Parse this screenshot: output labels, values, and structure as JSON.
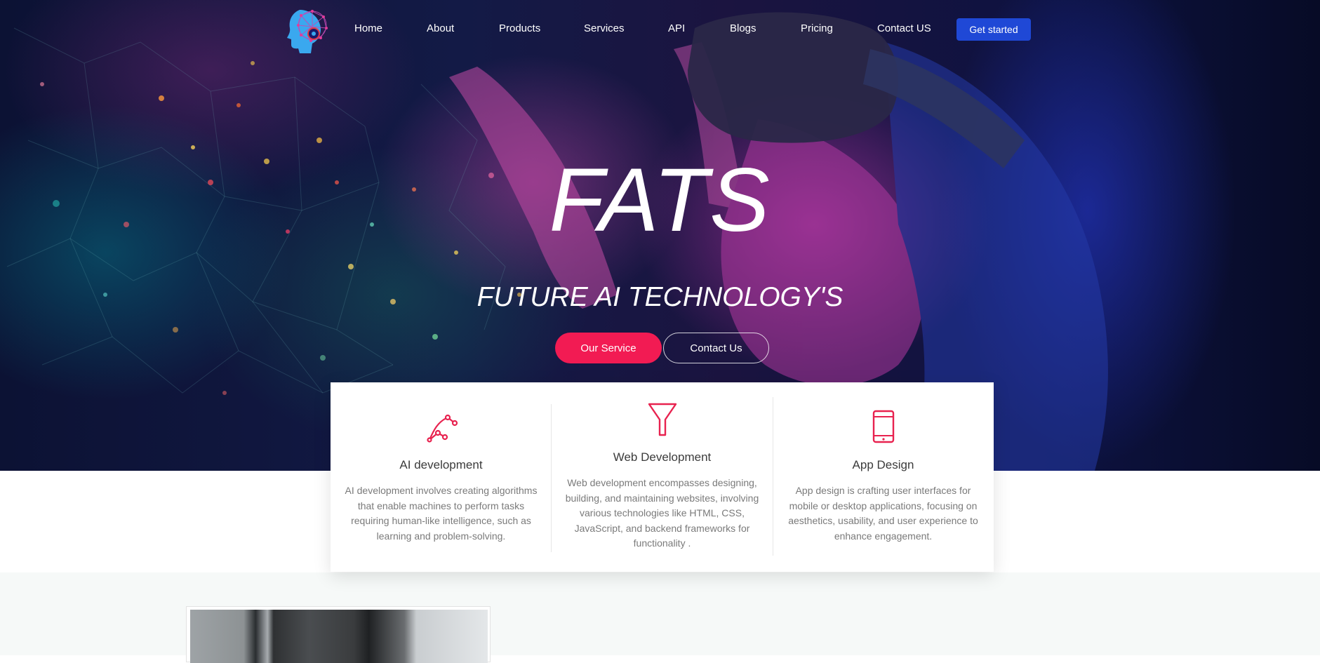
{
  "brand": {
    "logo_icon": "ai-head-logo-icon"
  },
  "nav": {
    "items": [
      {
        "label": "Home"
      },
      {
        "label": "About"
      },
      {
        "label": "Products"
      },
      {
        "label": "Services"
      },
      {
        "label": "API"
      },
      {
        "label": "Blogs"
      },
      {
        "label": "Pricing"
      },
      {
        "label": "Contact US"
      }
    ],
    "cta_label": "Get started"
  },
  "hero": {
    "title": "FATS",
    "subtitle": "FUTURE AI TECHNOLOGY'S",
    "primary_button": "Our Service",
    "secondary_button": "Contact Us"
  },
  "features": [
    {
      "icon": "bezier-curve-icon",
      "title": "AI development",
      "description": "AI development involves creating algorithms that enable machines to perform tasks requiring human-like intelligence, such as learning and problem-solving."
    },
    {
      "icon": "funnel-icon",
      "title": "Web Development",
      "description": "Web development encompasses designing, building, and maintaining websites, involving various technologies like HTML, CSS, JavaScript, and backend frameworks for functionality ."
    },
    {
      "icon": "tablet-icon",
      "title": "App Design",
      "description": "App design is crafting user interfaces for mobile or desktop applications, focusing on aesthetics, usability, and user experience to enhance engagement."
    }
  ],
  "colors": {
    "accent": "#f21b53",
    "brand_blue": "#1f48d6",
    "icon_red": "#e8224f"
  }
}
